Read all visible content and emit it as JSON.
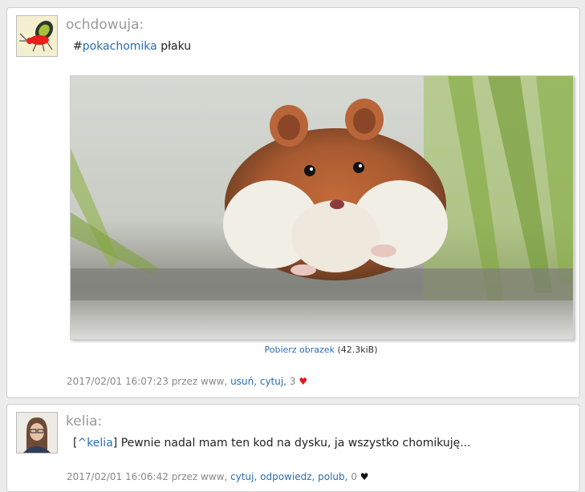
{
  "posts": [
    {
      "author": "ochdowuja:",
      "tag_prefix": "#",
      "tag": "pokachomika",
      "text": "płaku",
      "image_alt": "hamster",
      "download_link": "Pobierz obrazek",
      "download_size": "(42.3kiB)",
      "meta": {
        "timestamp": "2017/02/01 16:07:23 przez www,",
        "delete": "usuń,",
        "quote": "cytuj,",
        "likes": "3",
        "heart": "♥",
        "heart_color": "#e0161b"
      }
    },
    {
      "author": "kelia:",
      "reply_open": "[",
      "reply_user": "^kelia",
      "reply_close": "]",
      "text": "Pewnie nadal mam ten kod na dysku, ja wszystko chomikuję...",
      "meta": {
        "timestamp": "2017/02/01 16:06:42 przez www,",
        "quote": "cytuj,",
        "reply": "odpowiedz,",
        "like": "polub,",
        "likes": "0",
        "heart": "♥",
        "heart_color": "#111111"
      }
    }
  ],
  "colors": {
    "link": "#2a6db0",
    "muted": "#888888",
    "background": "#ececec"
  }
}
